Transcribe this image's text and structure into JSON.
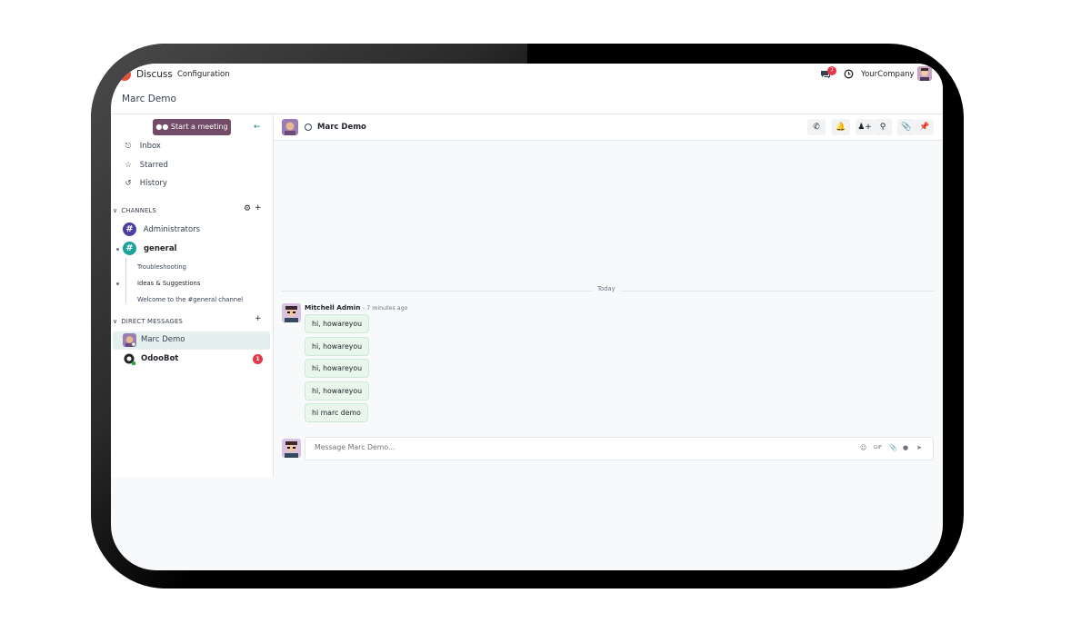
{
  "topbar": {
    "app_name": "Discuss",
    "menu_configuration": "Configuration",
    "messaging_badge": "7",
    "company": "YourCompany"
  },
  "breadcrumb": {
    "title": "Marc Demo"
  },
  "sidebar": {
    "start_meeting": "Start a meeting",
    "nav": [
      {
        "label": "Inbox",
        "icon": "inbox-icon"
      },
      {
        "label": "Starred",
        "icon": "star-icon"
      },
      {
        "label": "History",
        "icon": "history-icon"
      }
    ],
    "channels_header": "CHANNELS",
    "channels": [
      {
        "label": "Administrators",
        "color": "#4b3fa0"
      },
      {
        "label": "general",
        "color": "#1aa39a"
      }
    ],
    "sub_channels": [
      "Troubleshooting",
      "Ideas & Suggestions",
      "Welcome to the #general channel"
    ],
    "dm_header": "DIRECT MESSAGES",
    "dms": [
      {
        "label": "Marc Demo"
      },
      {
        "label": "OdooBot",
        "unread": "1"
      }
    ]
  },
  "thread": {
    "name": "Marc Demo",
    "date_separator": "Today",
    "author": "Mitchell Admin",
    "time": "- 7 minutes ago",
    "messages": [
      "hi, howareyou",
      "hi, howareyou",
      "hi, howareyou",
      "hi, howareyou",
      "hi marc demo"
    ],
    "composer_placeholder": "Message Marc Demo..."
  },
  "colors": {
    "brand": "#714b67",
    "accent": "#017e84",
    "badge": "#e3384a"
  }
}
